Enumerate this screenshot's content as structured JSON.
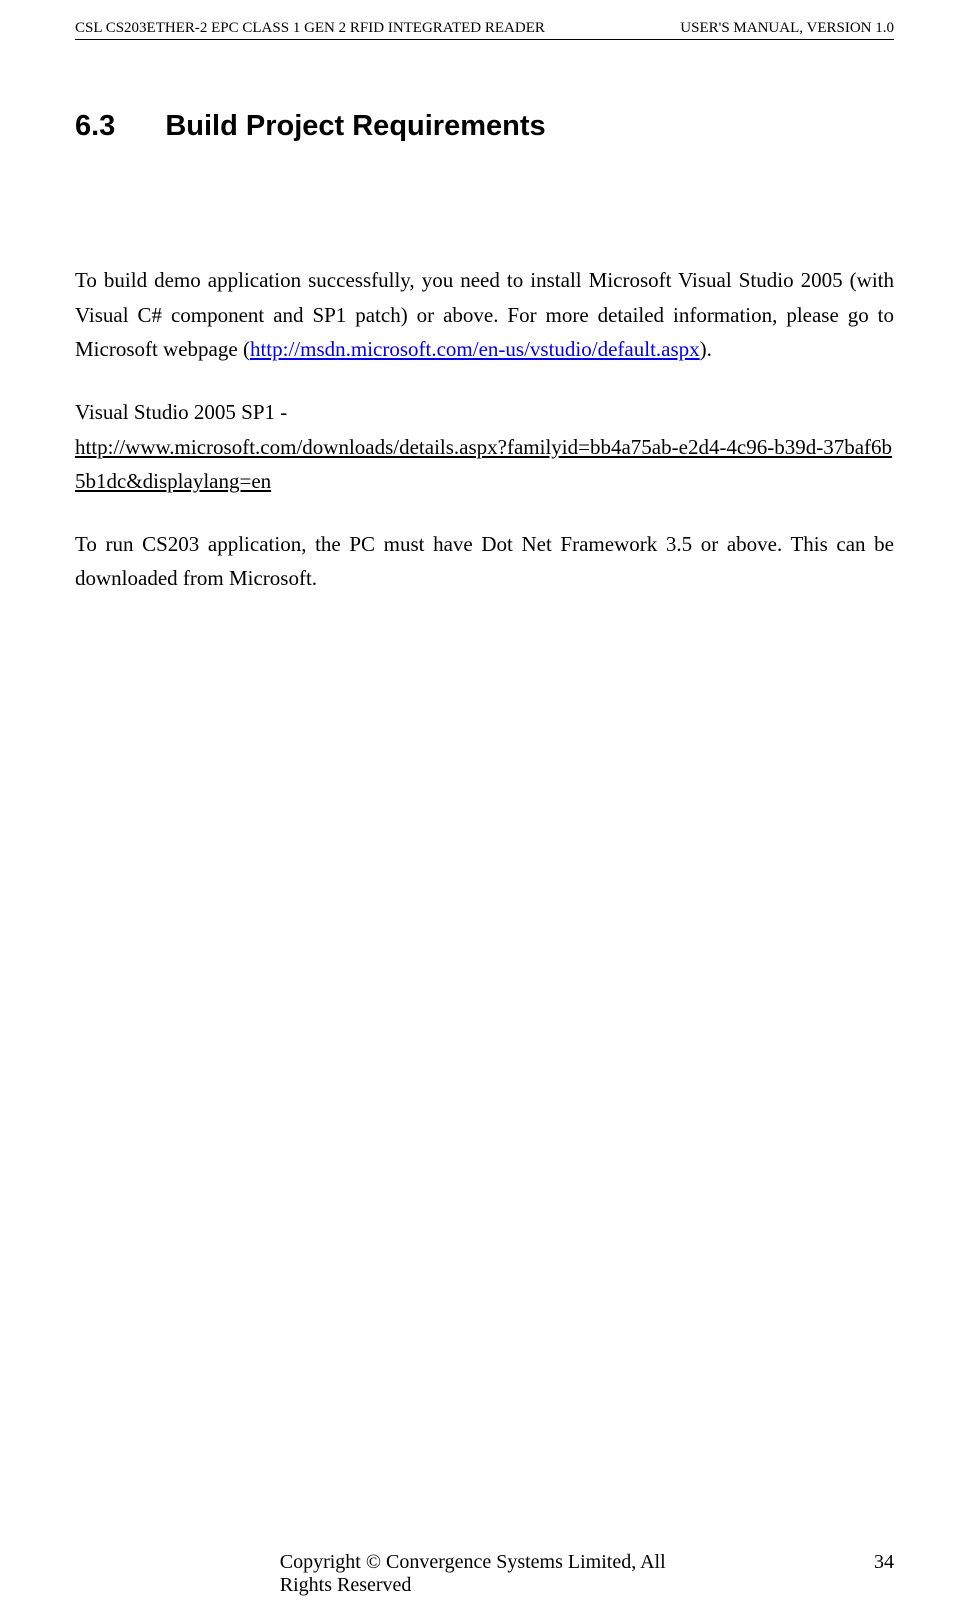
{
  "header": {
    "left": "CSL CS203ETHER-2 EPC CLASS 1 GEN 2 RFID INTEGRATED READER",
    "right": "USER'S  MANUAL,  VERSION  1.0"
  },
  "section": {
    "number": "6.3",
    "title": "Build Project Requirements"
  },
  "paragraphs": {
    "p1_a": "To build demo application successfully, you need to install Microsoft Visual Studio 2005 (with Visual C# component and SP1 patch) or above. For more detailed information, please go to Microsoft webpage (",
    "p1_link": "http://msdn.microsoft.com/en-us/vstudio/default.aspx",
    "p1_b": ").",
    "p2_label": "Visual Studio 2005 SP1 -",
    "p2_link": "http://www.microsoft.com/downloads/details.aspx?familyid=bb4a75ab-e2d4-4c96-b39d-37baf6b5b1dc&displaylang=en",
    "p3": "To run CS203 application, the PC must have Dot Net Framework 3.5 or above.   This can be downloaded from Microsoft."
  },
  "footer": {
    "center": "Copyright © Convergence Systems Limited, All Rights Reserved",
    "page": "34"
  }
}
